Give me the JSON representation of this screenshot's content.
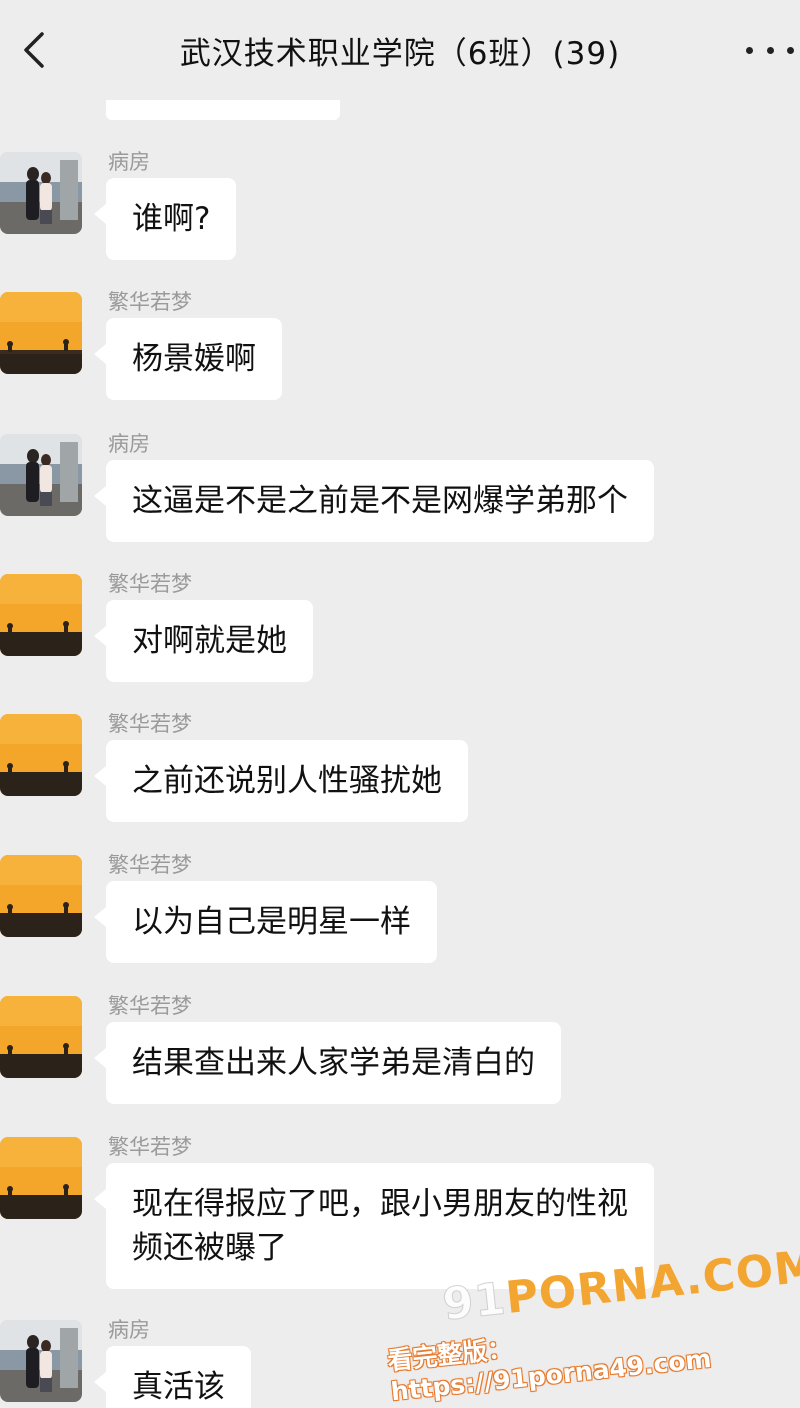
{
  "header": {
    "title": "武汉技术职业学院（6班）(39)"
  },
  "icons": {
    "back": "chevron-left-icon",
    "more": "more-dots-icon"
  },
  "messages": [
    {
      "sender": "病房",
      "text": "谁啊?",
      "avatar": "couple-photo"
    },
    {
      "sender": "繁华若梦",
      "text": "杨景媛啊",
      "avatar": "sunset-silhouette"
    },
    {
      "sender": "病房",
      "text": "这逼是不是之前是不是网爆学弟那个",
      "avatar": "couple-photo"
    },
    {
      "sender": "繁华若梦",
      "text": "对啊就是她",
      "avatar": "sunset-silhouette"
    },
    {
      "sender": "繁华若梦",
      "text": "之前还说别人性骚扰她",
      "avatar": "sunset-silhouette"
    },
    {
      "sender": "繁华若梦",
      "text": "以为自己是明星一样",
      "avatar": "sunset-silhouette"
    },
    {
      "sender": "繁华若梦",
      "text": "结果查出来人家学弟是清白的",
      "avatar": "sunset-silhouette"
    },
    {
      "sender": "繁华若梦",
      "text_line1": "现在得报应了吧，跟小男朋友的性视",
      "text_line2": "频还被曝了",
      "avatar": "sunset-silhouette"
    },
    {
      "sender": "病房",
      "text": "真活该",
      "avatar": "couple-photo"
    }
  ],
  "watermark": {
    "logo_prefix": "91",
    "logo_text": "PORNA.COM",
    "url_text": "看完整版：https://91porna49.com"
  }
}
